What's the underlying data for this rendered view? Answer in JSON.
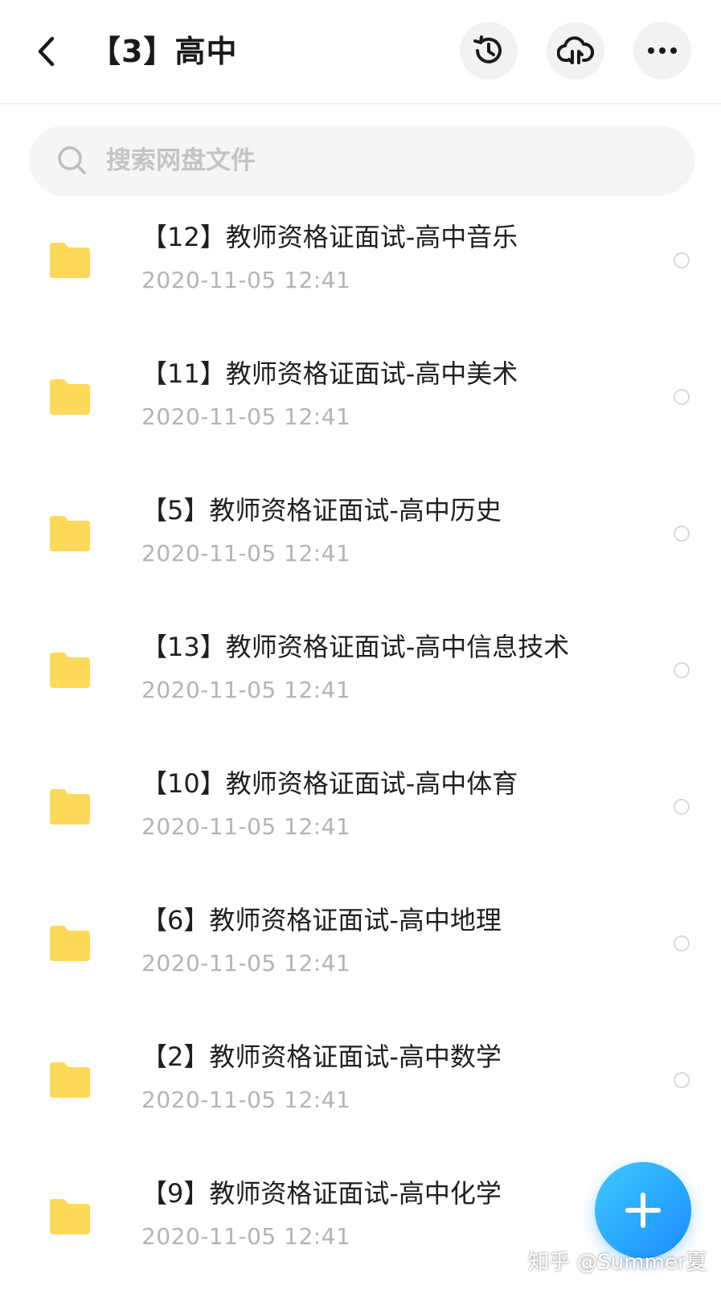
{
  "header": {
    "title": "【3】高中",
    "back_icon": "chevron-left-icon",
    "history_icon": "history-clock-icon",
    "cloud_icon": "cloud-transfer-icon",
    "more_icon": "more-horizontal-icon"
  },
  "search": {
    "placeholder": "搜索网盘文件",
    "value": ""
  },
  "files": [
    {
      "name": "【12】教师资格证面试-高中音乐",
      "date": "2020-11-05  12:41"
    },
    {
      "name": "【11】教师资格证面试-高中美术",
      "date": "2020-11-05  12:41"
    },
    {
      "name": "【5】教师资格证面试-高中历史",
      "date": "2020-11-05  12:41"
    },
    {
      "name": "【13】教师资格证面试-高中信息技术",
      "date": "2020-11-05  12:41"
    },
    {
      "name": "【10】教师资格证面试-高中体育",
      "date": "2020-11-05  12:41"
    },
    {
      "name": "【6】教师资格证面试-高中地理",
      "date": "2020-11-05  12:41"
    },
    {
      "name": "【2】教师资格证面试-高中数学",
      "date": "2020-11-05  12:41"
    },
    {
      "name": "【9】教师资格证面试-高中化学",
      "date": "2020-11-05  12:41"
    }
  ],
  "fab_icon": "plus-icon",
  "watermark": "知乎 @Summer夏",
  "colors": {
    "folder": "#ffd95a",
    "accent": "#1a8cff"
  }
}
